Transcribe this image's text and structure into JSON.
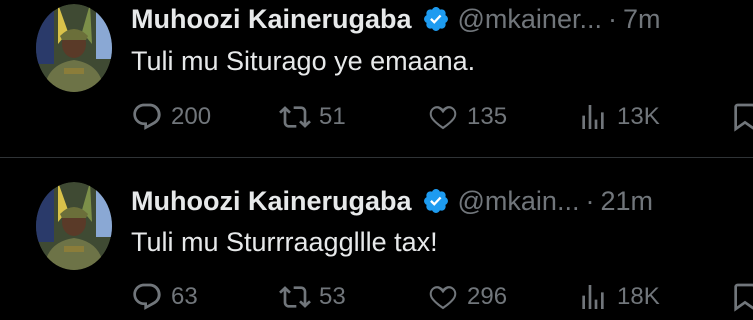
{
  "colors": {
    "background": "#000000",
    "text": "#e7e9ea",
    "muted": "#71767b",
    "verified": "#1d9bf0"
  },
  "tweets": [
    {
      "author_name": "Muhoozi Kainerugaba",
      "handle": "@mkainer...",
      "separator": "·",
      "time": "7m",
      "text": "Tuli mu Siturago ye emaana.",
      "replies": "200",
      "retweets": "51",
      "likes": "135",
      "views": "13K"
    },
    {
      "author_name": "Muhoozi Kainerugaba",
      "handle": "@mkain...",
      "separator": "·",
      "time": "21m",
      "text": "Tuli mu Sturrraaggllle tax!",
      "replies": "63",
      "retweets": "53",
      "likes": "296",
      "views": "18K"
    }
  ],
  "icons": {
    "reply": "reply-icon",
    "retweet": "retweet-icon",
    "like": "heart-icon",
    "views": "views-icon",
    "bookmark": "bookmark-icon",
    "verified": "verified-badge-icon"
  }
}
